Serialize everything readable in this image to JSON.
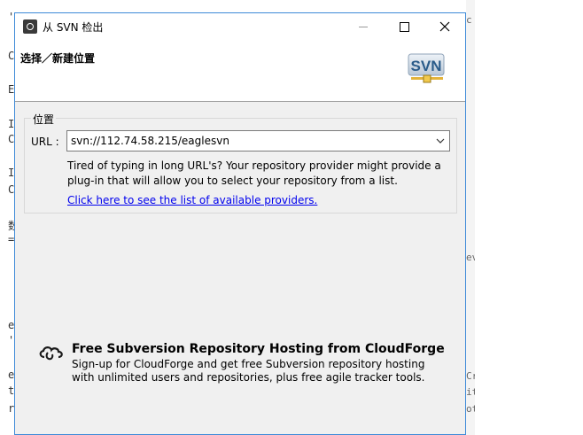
{
  "window": {
    "title": "从 SVN 检出",
    "icon": "eclipse-app-icon"
  },
  "header": {
    "title": "选择／新建位置",
    "logo_text": "SVN"
  },
  "location_group": {
    "legend": "位置",
    "url_label": "URL :",
    "url_value": "svn://112.74.58.215/eaglesvn",
    "help_text": "Tired of typing in long URL's?  Your repository provider might provide a plug-in that will allow you to select your repository from a list.",
    "providers_link": "Click here to see the list of available providers."
  },
  "cloudforge": {
    "title": "Free Subversion Repository Hosting from CloudForge",
    "description": "Sign-up for CloudForge and get free Subversion repository hosting with unlimited users and repositories, plus free agile tracker tools."
  },
  "background_editor": {
    "left_chars": [
      "'",
      "C",
      "E",
      "I",
      "C",
      "I",
      "C",
      "数",
      "=",
      "e",
      "'",
      "e",
      "t",
      "r"
    ],
    "right_chars": [
      "c",
      "ev",
      "Cr",
      "it",
      "ot"
    ]
  },
  "colors": {
    "dialog_border": "#3e8ad8",
    "dialog_bg": "#f0f0f0",
    "link": "#0000ee"
  }
}
